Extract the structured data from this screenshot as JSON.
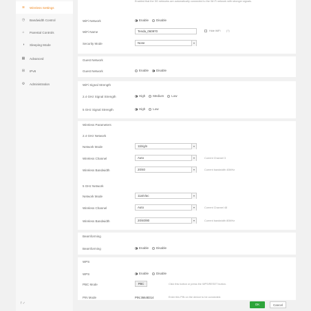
{
  "sidebar": {
    "items": [
      {
        "label": "Wireless Settings",
        "icon": "wifi-icon"
      },
      {
        "label": "Bandwidth Control",
        "icon": "gauge-icon"
      },
      {
        "label": "Parental Controls",
        "icon": "home-icon"
      },
      {
        "label": "Sleeping Mode",
        "icon": "moon-icon"
      },
      {
        "label": "Advanced",
        "icon": "grid-icon"
      },
      {
        "label": "IPv6",
        "icon": "network-icon"
      },
      {
        "label": "Administration",
        "icon": "gear-icon"
      }
    ],
    "footer_icons": "f  ✓"
  },
  "top_note": "Enabled that the 5G networks are automatically connected to the Wi-Fi network with stronger signals.",
  "wifi": {
    "network_label": "WiFi Network",
    "network_enable": "Enable",
    "network_disable": "Disable",
    "name_label": "WiFi Name",
    "name_value": "Tenda_060970",
    "hide_wifi": "Hide WiFi",
    "hide_hint": "(?)",
    "security_label": "Security Mode",
    "security_value": "None"
  },
  "guest": {
    "title": "Guest Network",
    "label": "Guest Network",
    "enable": "Enable",
    "disable": "Disable"
  },
  "signal": {
    "title": "WiFi Signal Strength",
    "g24_label": "2.4 GHz Signal Strength",
    "g24_high": "High",
    "g24_medium": "Medium",
    "g24_low": "Low",
    "g5_label": "5 GHz Signal Strength",
    "g5_high": "High",
    "g5_low": "Low"
  },
  "wireless": {
    "title": "Wireless Parameters",
    "g24_title": "2.4 GHz Network",
    "g24_mode_label": "Network Mode",
    "g24_mode_value": "11b/g/n",
    "g24_channel_label": "Wireless Channel",
    "g24_channel_value": "Auto",
    "g24_channel_hint": "Current Channel 3",
    "g24_bw_label": "Wireless Bandwidth",
    "g24_bw_value": "20/40",
    "g24_bw_hint": "Current bandwidth 40MHz",
    "g5_title": "5 GHz Network",
    "g5_mode_label": "Network Mode",
    "g5_mode_value": "11a/n/ac",
    "g5_channel_label": "Wireless Channel",
    "g5_channel_value": "Auto",
    "g5_channel_hint": "Current Channel 48",
    "g5_bw_label": "Wireless Bandwidth",
    "g5_bw_value": "20/40/80",
    "g5_bw_hint": "Current bandwidth 80MHz"
  },
  "beamforming": {
    "title": "Beamforming",
    "label": "Beamforming",
    "enable": "Enable",
    "disable": "Disable"
  },
  "wps": {
    "title": "WPS",
    "label": "WPS",
    "enable": "Enable",
    "disable": "Disable",
    "pbc_label": "PBC Mode",
    "pbc_button": "PBC",
    "pbc_hint": "Click this button or press the WPS/RESET button.",
    "pin_label": "PIN Mode",
    "pin_value": "PIN:36648314",
    "pin_hint": "Enter this PIN on the device to be connected."
  },
  "actions": {
    "ok": "OK",
    "cancel": "Cancel"
  }
}
